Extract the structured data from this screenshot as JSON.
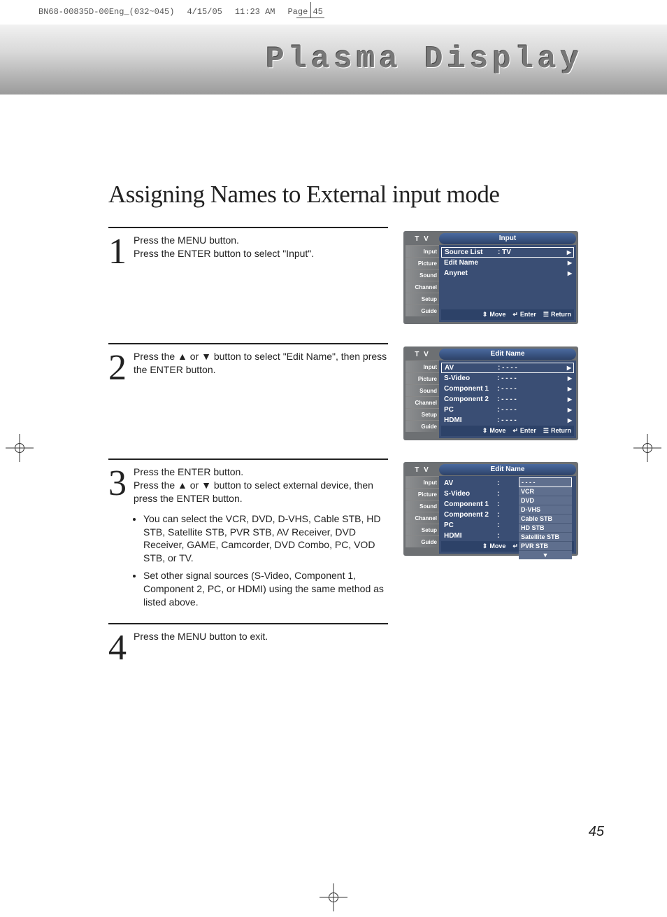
{
  "meta": {
    "doc_id": "BN68-00835D-00Eng_(032~045)",
    "date": "4/15/05",
    "time": "11:23 AM",
    "page_label": "Page 45"
  },
  "header": {
    "title": "Plasma Display"
  },
  "page_title": "Assigning Names to External input mode",
  "steps": {
    "s1": {
      "num": "1",
      "line1": "Press the MENU button.",
      "line2": "Press the ENTER button to select \"Input\"."
    },
    "s2": {
      "num": "2",
      "line1": "Press the ▲ or ▼ button to select \"Edit Name\", then press the ENTER button."
    },
    "s3": {
      "num": "3",
      "line1": "Press the ENTER button.",
      "line2": "Press the ▲ or ▼ button to select external device, then press the ENTER button.",
      "bullet1": "You can select the VCR, DVD, D-VHS, Cable STB, HD STB, Satellite STB, PVR STB, AV Receiver, DVD Receiver, GAME, Camcorder, DVD Combo, PC, VOD STB, or TV.",
      "bullet2": "Set other signal sources (S-Video, Component 1, Component 2, PC, or HDMI) using the same method as listed above."
    },
    "s4": {
      "num": "4",
      "line1": "Press the MENU button to exit."
    }
  },
  "osd_common": {
    "tv": "T V",
    "sidebar": [
      "Input",
      "Picture",
      "Sound",
      "Channel",
      "Setup",
      "Guide"
    ],
    "move": "Move",
    "enter": "Enter",
    "return": "Return"
  },
  "osd1": {
    "title": "Input",
    "rows": [
      {
        "label": "Source List",
        "value": ": TV",
        "sel": true
      },
      {
        "label": "Edit Name",
        "value": "",
        "sel": false
      },
      {
        "label": "Anynet",
        "value": "",
        "sel": false
      }
    ]
  },
  "osd2": {
    "title": "Edit Name",
    "rows": [
      {
        "label": "AV",
        "value": ": - - - -",
        "sel": true
      },
      {
        "label": "S-Video",
        "value": ": - - - -",
        "sel": false
      },
      {
        "label": "Component 1",
        "value": ": - - - -",
        "sel": false
      },
      {
        "label": "Component 2",
        "value": ": - - - -",
        "sel": false
      },
      {
        "label": "PC",
        "value": ": - - - -",
        "sel": false
      },
      {
        "label": "HDMI",
        "value": ": - - - -",
        "sel": false
      }
    ]
  },
  "osd3": {
    "title": "Edit Name",
    "rows": [
      {
        "label": "AV",
        "value": ":"
      },
      {
        "label": "S-Video",
        "value": ":"
      },
      {
        "label": "Component 1",
        "value": ":"
      },
      {
        "label": "Component 2",
        "value": ":"
      },
      {
        "label": "PC",
        "value": ":"
      },
      {
        "label": "HDMI",
        "value": ":"
      }
    ],
    "dropdown": [
      "- - - -",
      "VCR",
      "DVD",
      "D-VHS",
      "Cable STB",
      "HD STB",
      "Satellite STB",
      "PVR STB"
    ]
  },
  "page_number": "45"
}
